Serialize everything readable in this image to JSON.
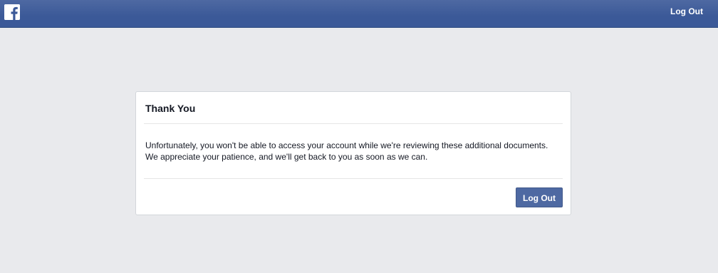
{
  "header": {
    "logo_icon": "facebook-f-icon",
    "logout_label": "Log Out",
    "brand_color": "#3b5998"
  },
  "dialog": {
    "title": "Thank You",
    "body_lines": [
      "Unfortunately, you won't be able to access your account while we're reviewing these additional documents.",
      "We appreciate your patience, and we'll get back to you as soon as we can."
    ],
    "button_label": "Log Out"
  }
}
